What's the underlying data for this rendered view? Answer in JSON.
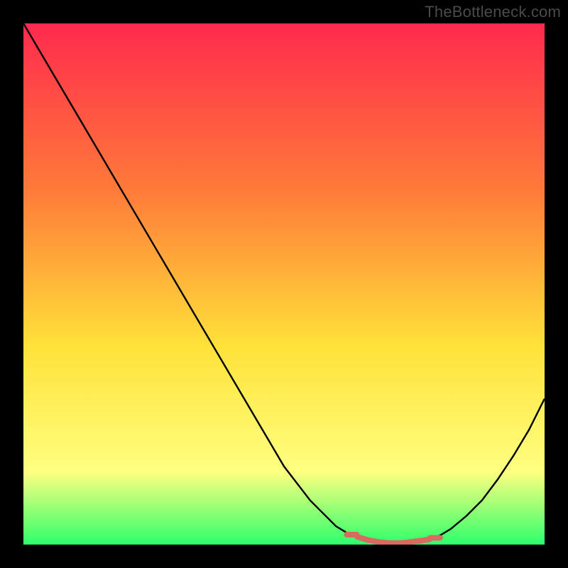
{
  "attribution": "TheBottleneck.com",
  "colors": {
    "frame": "#000000",
    "gradient_top": "#ff2a4d",
    "gradient_mid1": "#ff7a3a",
    "gradient_mid2": "#ffe23a",
    "gradient_mid3": "#ffff80",
    "gradient_bottom": "#2fff6b",
    "curve": "#000000",
    "marker": "#d86a5f"
  },
  "chart_data": {
    "type": "line",
    "title": "",
    "xlabel": "",
    "ylabel": "",
    "xlim": [
      0,
      100
    ],
    "ylim": [
      0,
      100
    ],
    "series": [
      {
        "name": "curve",
        "x": [
          0,
          5,
          10,
          15,
          20,
          25,
          30,
          35,
          40,
          45,
          50,
          55,
          60,
          62,
          64,
          66,
          68,
          70,
          72,
          74,
          76,
          78,
          80,
          82,
          85,
          88,
          91,
          94,
          97,
          100
        ],
        "values": [
          100,
          91.5,
          83,
          74.5,
          66,
          57.5,
          49,
          40.5,
          32,
          23.5,
          15,
          8.5,
          3.5,
          2.3,
          1.5,
          0.9,
          0.5,
          0.3,
          0.25,
          0.3,
          0.5,
          1.0,
          1.8,
          3.0,
          5.5,
          8.5,
          12.5,
          17.0,
          22.0,
          28.0
        ]
      }
    ],
    "markers": {
      "name": "highlighted-range",
      "x": [
        63,
        65,
        67,
        69,
        71,
        73,
        75,
        77,
        79
      ],
      "values": [
        1.9,
        1.2,
        0.7,
        0.4,
        0.28,
        0.35,
        0.6,
        0.85,
        1.3
      ]
    }
  }
}
